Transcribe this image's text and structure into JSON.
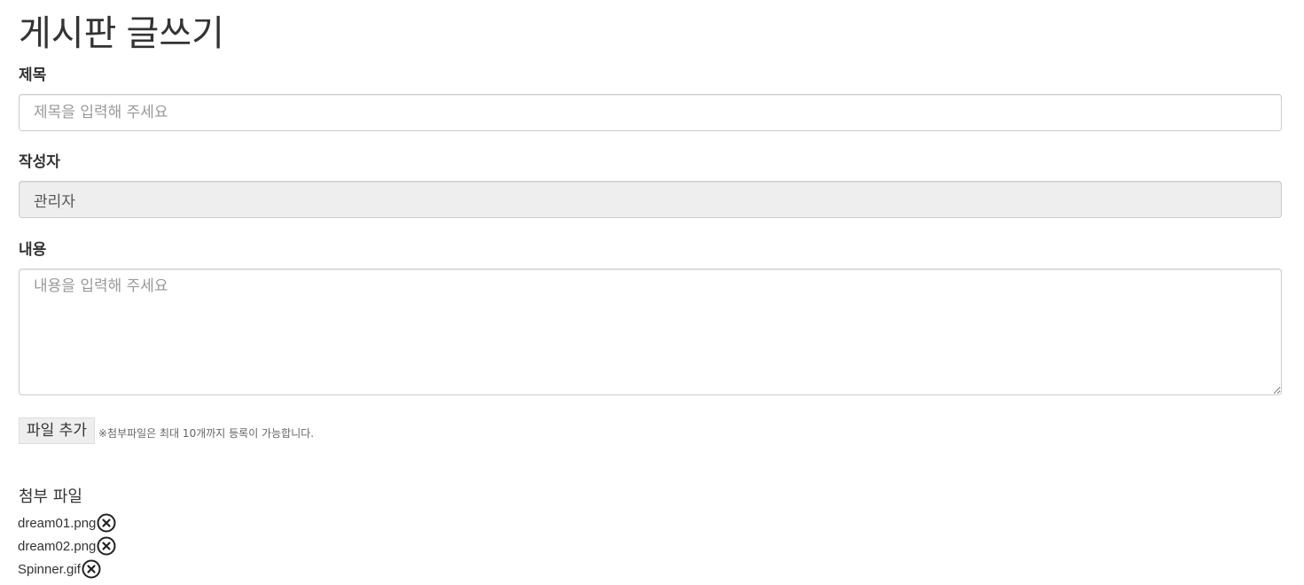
{
  "page": {
    "title": "게시판 글쓰기"
  },
  "form": {
    "title_label": "제목",
    "title_placeholder": "제목을 입력해 주세요",
    "author_label": "작성자",
    "author_value": "관리자",
    "content_label": "내용",
    "content_placeholder": "내용을 입력해 주세요",
    "file_add_label": "파일 추가",
    "file_hint": "※첨부파일은 최대 10개까지 등록이 가능합니다."
  },
  "attachments": {
    "title": "첨부 파일",
    "remove_icon": "circle-x-icon",
    "files": [
      {
        "name": "dream01.png"
      },
      {
        "name": "dream02.png"
      },
      {
        "name": "Spinner.gif"
      }
    ]
  }
}
